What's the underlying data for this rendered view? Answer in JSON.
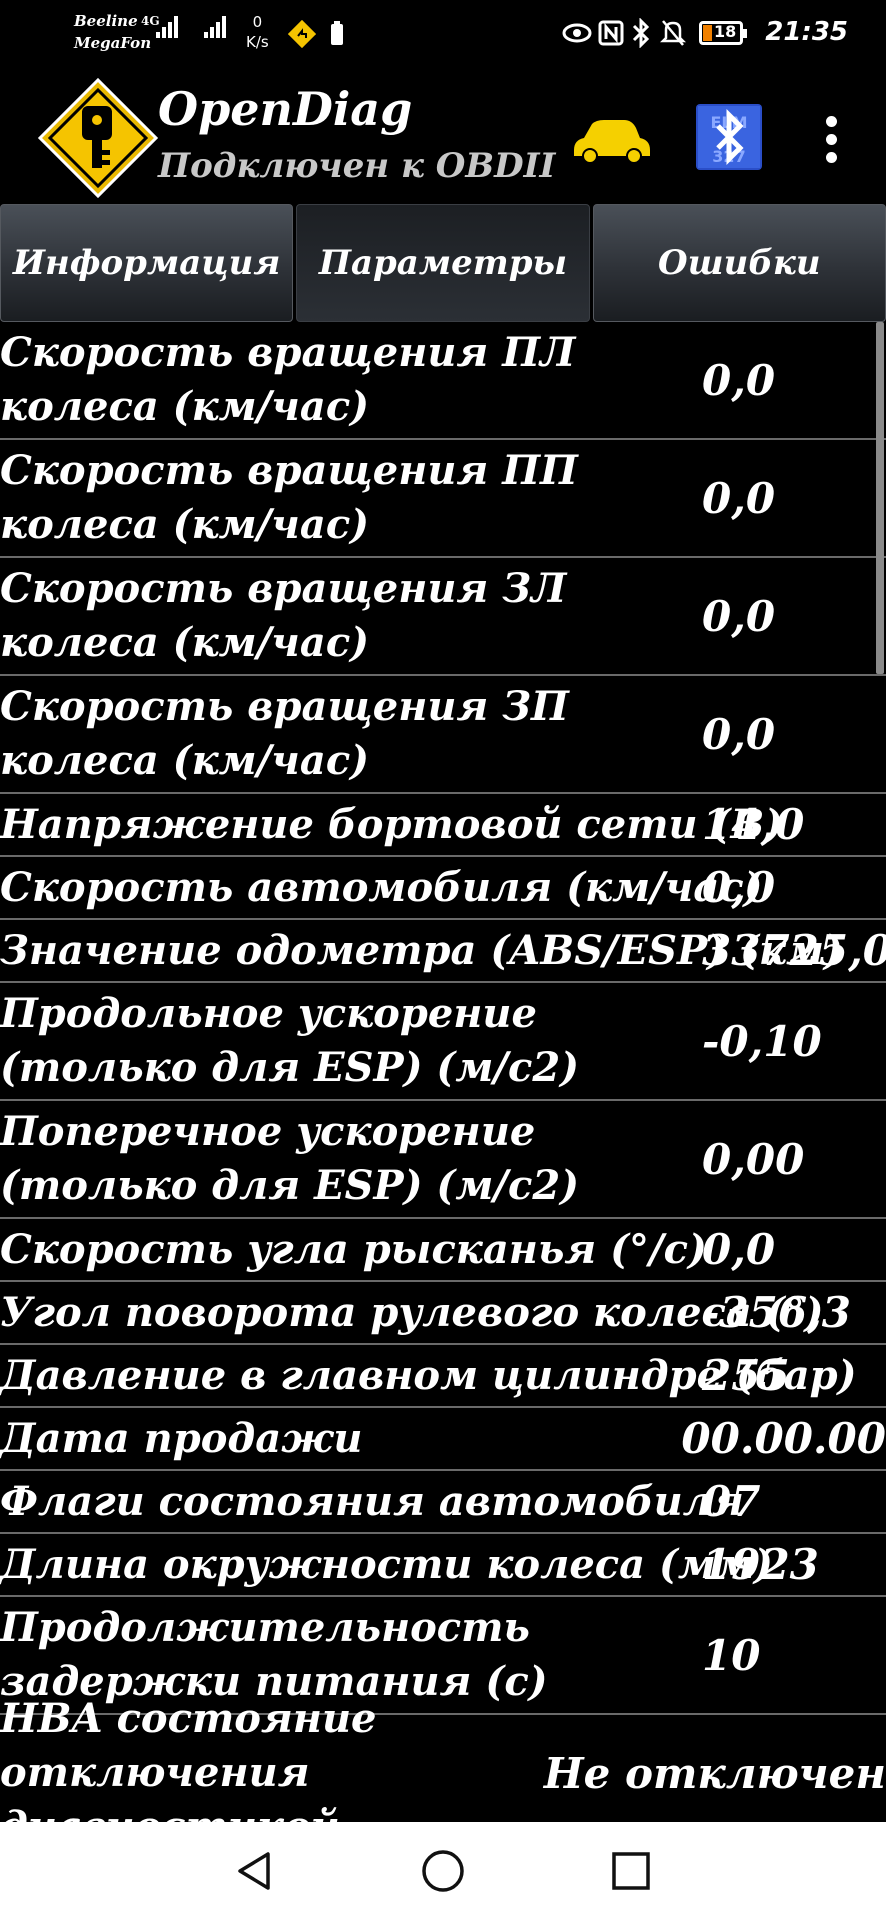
{
  "status_bar": {
    "carrier1": "Beeline",
    "carrier2": "MegaFon",
    "network": "4G",
    "speed_value": "0",
    "speed_unit": "K/s",
    "battery": "18",
    "time": "21:35"
  },
  "app_bar": {
    "title": "OpenDiag",
    "subtitle": "Подключен к OBDII"
  },
  "tabs": [
    {
      "label": "Информация",
      "active": false
    },
    {
      "label": "Параметры",
      "active": true
    },
    {
      "label": "Ошибки",
      "active": false
    }
  ],
  "params": [
    {
      "name": "Скорость вращения ПЛ колеса (км/час)",
      "value": "0,0"
    },
    {
      "name": "Скорость вращения ПП колеса (км/час)",
      "value": "0,0"
    },
    {
      "name": "Скорость вращения ЗЛ колеса (км/час)",
      "value": "0,0"
    },
    {
      "name": "Скорость вращения ЗП колеса (км/час)",
      "value": "0,0"
    },
    {
      "name": "Напряжение бортовой сети (В)",
      "value": "14,0"
    },
    {
      "name": "Скорость автомобиля (км/час)",
      "value": "0,0"
    },
    {
      "name": "Значение одометра (ABS/ESP) (км)",
      "value": "33725,0"
    },
    {
      "name": "Продольное ускорение (только для ESP) (м/с2)",
      "value": "-0,10"
    },
    {
      "name": "Поперечное ускорение (только для ESP) (м/с2)",
      "value": "0,00"
    },
    {
      "name": "Скорость угла рысканья (°/с)",
      "value": "0,0"
    },
    {
      "name": "Угол поворота рулевого колеса (°)",
      "value": "-356,3"
    },
    {
      "name": "Давление в главном цилиндре (бар)",
      "value": "255"
    },
    {
      "name": "Дата продажи",
      "value": "00.00.00"
    },
    {
      "name": "Флаги состояния автомобиля",
      "value": "07"
    },
    {
      "name": "Длина окружности колеса (мм)",
      "value": "1923"
    },
    {
      "name": "Продолжительность задержки питания (с)",
      "value": "10"
    },
    {
      "name": "HBA состояние отключения диагностикой",
      "value": "Не отключен"
    }
  ],
  "colors": {
    "background": "#000000",
    "text": "#ffffff",
    "logo_yellow": "#f5c400",
    "car_yellow": "#f5d000",
    "bluetooth_blue": "#2a4ec8",
    "battery_orange": "#f08000"
  },
  "icons": {
    "eye": "eye-icon",
    "nfc": "nfc-icon",
    "bluetooth": "bluetooth-icon",
    "mute": "bell-off-icon",
    "nav_warning": "warning-icon",
    "sim": "sim-icon",
    "back": "back-triangle-icon",
    "home": "home-circle-icon",
    "recents": "recents-square-icon"
  }
}
